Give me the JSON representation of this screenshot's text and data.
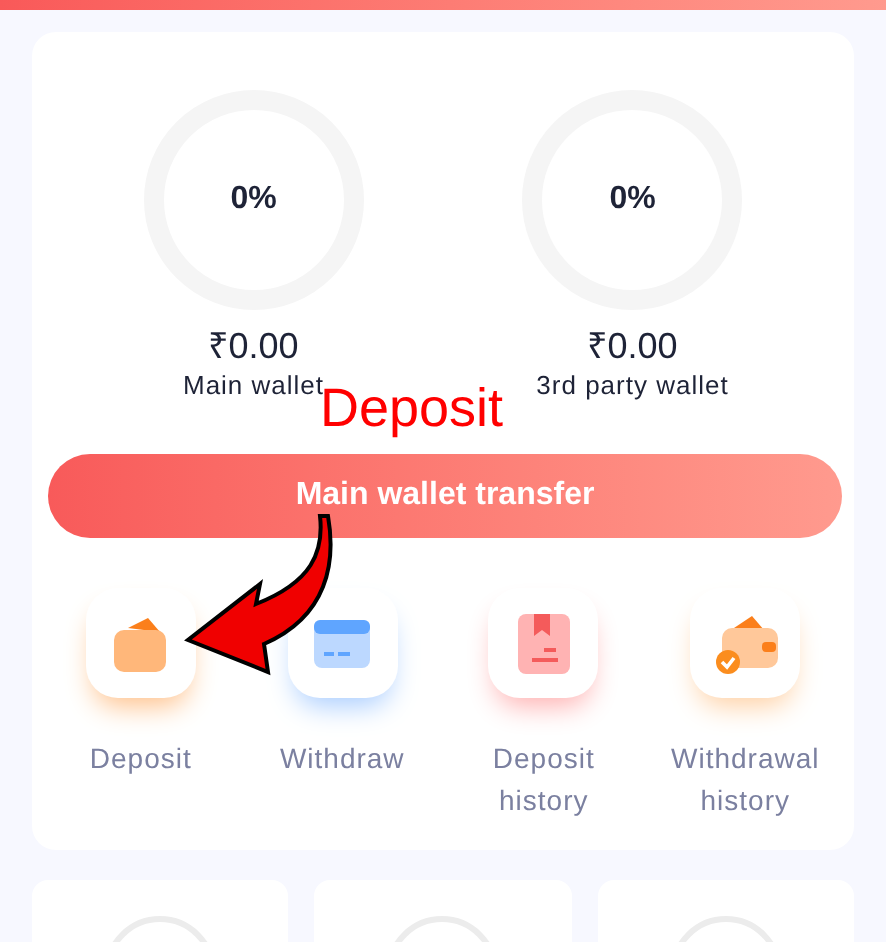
{
  "wallets": [
    {
      "percent": "0%",
      "amount": "₹0.00",
      "label": "Main wallet"
    },
    {
      "percent": "0%",
      "amount": "₹0.00",
      "label": "3rd party wallet"
    }
  ],
  "transfer_button": "Main wallet transfer",
  "actions": [
    {
      "kind": "deposit",
      "label": "Deposit"
    },
    {
      "kind": "withdraw",
      "label": "Withdraw"
    },
    {
      "kind": "deposit_history",
      "label": "Deposit history"
    },
    {
      "kind": "withdrawal_history",
      "label": "Withdrawal history"
    }
  ],
  "annotation": {
    "text": "Deposit"
  }
}
